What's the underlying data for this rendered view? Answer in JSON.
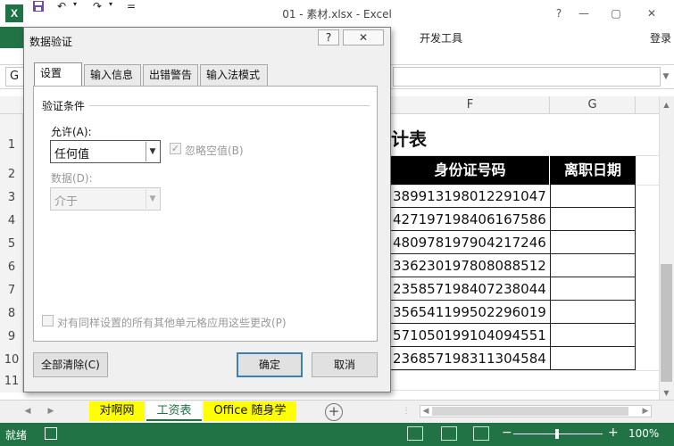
{
  "window": {
    "title": "01 - 素材.xlsx - Excel",
    "app_icon_letter": "X",
    "help_glyph": "?",
    "minimize_glyph": "—",
    "restore_glyph": "▢",
    "close_glyph": "✕"
  },
  "quick_access": {
    "undo": "↶",
    "redo": "↷",
    "customize": "="
  },
  "ribbon": {
    "visible_tabs": [
      "开发工具"
    ],
    "login": "登录"
  },
  "formula_bar": {
    "name_box": "G"
  },
  "grid": {
    "columns": [
      {
        "label": "F"
      },
      {
        "label": "G"
      }
    ],
    "rows": [
      "1",
      "2",
      "3",
      "4",
      "5",
      "6",
      "7",
      "8",
      "9",
      "10",
      "11"
    ],
    "title_fragment": "计表",
    "headers": [
      "身份证号码",
      "离职日期"
    ],
    "id_numbers": [
      "389913198012291047",
      "427197198406167586",
      "480978197904217246",
      "336230197808088512",
      "235857198407238044",
      "356541199502296019",
      "571050199104094551",
      "236857198311304584"
    ]
  },
  "sheets": {
    "tabs": [
      "对啊网",
      "工资表",
      "Office 随身学"
    ],
    "active": "工资表",
    "add_glyph": "+"
  },
  "statusbar": {
    "status": "就绪",
    "zoom": "100%",
    "zoom_minus": "−",
    "zoom_plus": "+"
  },
  "dialog": {
    "title": "数据验证",
    "help": "?",
    "close": "✕",
    "tabs": [
      "设置",
      "输入信息",
      "出错警告",
      "输入法模式"
    ],
    "active_tab": "设置",
    "section_title": "验证条件",
    "allow_label": "允许(A):",
    "allow_value": "任何值",
    "ignore_blank_label": "忽略空值(B)",
    "ignore_blank_checked": true,
    "data_label": "数据(D):",
    "data_value": "介于",
    "apply_all_label": "对有同样设置的所有其他单元格应用这些更改(P)",
    "buttons": {
      "clear_all": "全部清除(C)",
      "ok": "确定",
      "cancel": "取消"
    }
  },
  "colors": {
    "excel_green": "#217346",
    "sheet_tab_highlight": "#ffff00",
    "header_fill": "#000000",
    "ok_border": "#3c7fb1"
  }
}
